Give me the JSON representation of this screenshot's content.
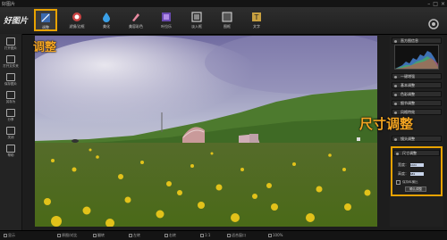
{
  "app": {
    "title": "好图片"
  },
  "toolbar": {
    "logo": "好图片",
    "tools": [
      {
        "label": "调整"
      },
      {
        "label": "滤镜/边框"
      },
      {
        "label": "美化"
      },
      {
        "label": "美容彩色"
      },
      {
        "label": "叶拉乐"
      },
      {
        "label": "淡入框"
      },
      {
        "label": "图框"
      },
      {
        "label": "文字"
      }
    ]
  },
  "sidebar": {
    "items": [
      {
        "label": "打开图片"
      },
      {
        "label": "打开文件夹"
      },
      {
        "label": "保存图片"
      },
      {
        "label": "另存为"
      },
      {
        "label": "分享"
      },
      {
        "label": "关闭"
      },
      {
        "label": "帮助"
      }
    ]
  },
  "right_panel": {
    "sections": [
      "直方图信息",
      "一键增强",
      "基本调整",
      "色彩调整",
      "细节调整",
      "风格特效",
      "镜头调整",
      "尺寸调整"
    ],
    "size": {
      "width_label": "宽度：",
      "width_value": "1024",
      "height_label": "高度：",
      "height_value": "683",
      "keep_ratio_label": "保持纵横比",
      "apply_label": "确认调整"
    }
  },
  "annotations": {
    "adjust": "调整",
    "size_adjust": "尺寸调整"
  },
  "statusbar": {
    "items": [
      "显示",
      "原图/对比",
      "翻转",
      "左转",
      "右转",
      "1:1",
      "适合窗口",
      "100%"
    ]
  },
  "colors": {
    "accent": "#e8a200",
    "annotation": "#f5a623"
  }
}
